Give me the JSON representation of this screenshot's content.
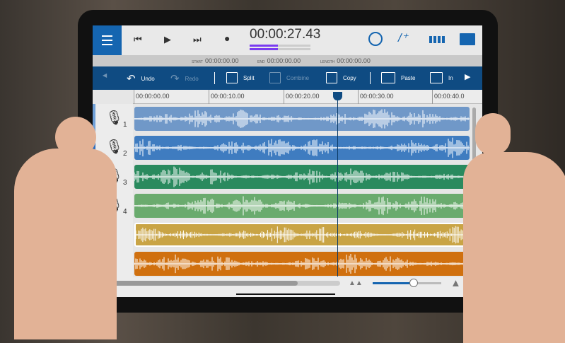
{
  "transport": {
    "time": "00:00:27.43",
    "start_label": "START",
    "start": "00:00:00.00",
    "end_label": "END",
    "end": "00:00:00.00",
    "length_label": "LENGTH",
    "length": "00:00:00.00",
    "playback_progress": 0.58
  },
  "toolbar": {
    "undo": "Undo",
    "redo": "Redo",
    "split": "Split",
    "combine": "Combine",
    "copy": "Copy",
    "paste": "Paste",
    "insert": "In"
  },
  "ruler": [
    "00:00:00.00",
    "00:00:10.00",
    "00:00:20.00",
    "00:00:30.00",
    "00:00:40.0"
  ],
  "tracks": [
    {
      "num": "1",
      "icon": "microphone-icon",
      "color": "#7098c8",
      "stripe": "#6fa0d8"
    },
    {
      "num": "2",
      "icon": "microphone-icon",
      "color": "#3f7cc0",
      "stripe": "#2d6fc0"
    },
    {
      "num": "3",
      "icon": "microphone-icon",
      "color": "#2a8a5e",
      "stripe": "#1d7a48"
    },
    {
      "num": "4",
      "icon": "microphone-icon",
      "color": "#6aab6e",
      "stripe": "#4ca656"
    },
    {
      "num": "",
      "icon": "usb-icon",
      "color": "#c9a445",
      "stripe": "#e2b028"
    },
    {
      "num": "",
      "icon": "phone-icon",
      "color": "#d0700f",
      "stripe": "#d9d9d9"
    }
  ],
  "zoom_level": 0.6,
  "colors": {
    "accent": "#1565b0",
    "toolbar": "#0f4b82"
  }
}
